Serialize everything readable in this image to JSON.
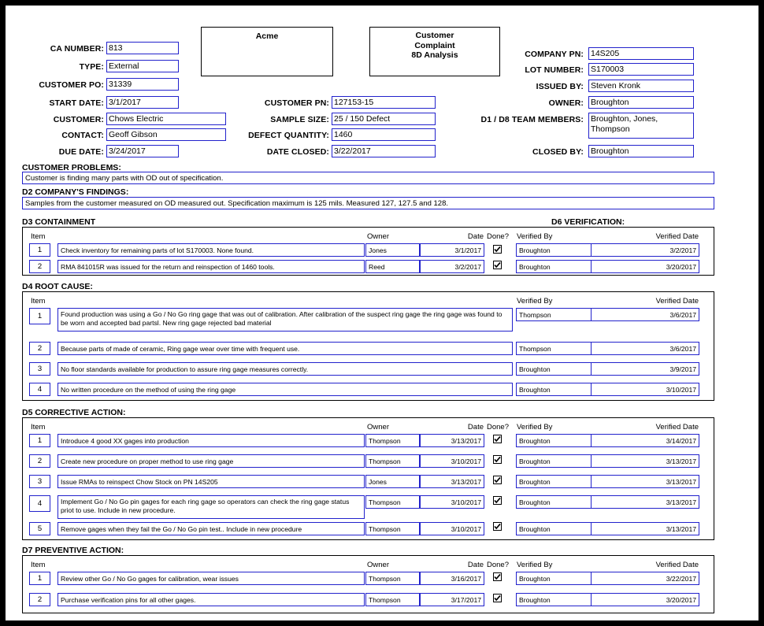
{
  "header": {
    "company_box": "Acme",
    "doc_type_box": "Customer\nComplaint\n8D Analysis",
    "doc_type_line1": "Customer",
    "doc_type_line2": "Complaint",
    "doc_type_line3": "8D Analysis",
    "left_fields": [
      {
        "label": "CA NUMBER:",
        "value": "813"
      },
      {
        "label": "TYPE:",
        "value": "External"
      },
      {
        "label": "CUSTOMER PO:",
        "value": "31339"
      },
      {
        "label": "START DATE:",
        "value": "3/1/2017"
      },
      {
        "label": "CUSTOMER:",
        "value": "Chows Electric"
      },
      {
        "label": "CONTACT:",
        "value": "Geoff Gibson"
      },
      {
        "label": "DUE DATE:",
        "value": "3/24/2017"
      }
    ],
    "mid_fields": [
      {
        "label": "CUSTOMER PN:",
        "value": "127153-15"
      },
      {
        "label": "SAMPLE SIZE:",
        "value": "25 / 150 Defect"
      },
      {
        "label": "DEFECT QUANTITY:",
        "value": "1460"
      },
      {
        "label": "DATE CLOSED:",
        "value": "3/22/2017"
      }
    ],
    "right_fields": [
      {
        "label": "COMPANY PN:",
        "value": "14S205"
      },
      {
        "label": "LOT NUMBER:",
        "value": "S170003"
      },
      {
        "label": "ISSUED BY:",
        "value": "Steven Kronk"
      },
      {
        "label": "OWNER:",
        "value": "Broughton"
      },
      {
        "label": "D1 / D8 TEAM MEMBERS:",
        "value": "Broughton, Jones, Thompson"
      },
      {
        "label": "CLOSED BY:",
        "value": "Broughton"
      }
    ]
  },
  "customer_problems": {
    "title": "CUSTOMER PROBLEMS:",
    "text": "Customer is finding many parts with OD out of specification."
  },
  "d2": {
    "title": "D2 COMPANY'S FINDINGS:",
    "text": "Samples from the customer measured on OD measured out.  Specification maximum is 125 mils.  Measured 127, 127.5 and 128."
  },
  "d3": {
    "title": "D3 CONTAINMENT",
    "verification_title": "D6  VERIFICATION:",
    "columns": {
      "item": "Item",
      "owner": "Owner",
      "date": "Date",
      "done": "Done?",
      "verified_by": "Verified By",
      "verified_date": "Verified Date"
    },
    "rows": [
      {
        "item": "1",
        "action": "Check inventory for remaining parts of lot S170003.  None found.",
        "owner": "Jones",
        "date": "3/1/2017",
        "done": true,
        "verified_by": "Broughton",
        "verified_date": "3/2/2017"
      },
      {
        "item": "2",
        "action": "RMA 841015R was issued for the return and reinspection of 1460 tools.",
        "owner": "Reed",
        "date": "3/2/2017",
        "done": true,
        "verified_by": "Broughton",
        "verified_date": "3/20/2017"
      }
    ]
  },
  "d4": {
    "title": "D4  ROOT CAUSE:",
    "columns": {
      "item": "Item",
      "verified_by": "Verified By",
      "verified_date": "Verified Date"
    },
    "rows": [
      {
        "item": "1",
        "action": "Found production was using a  Go / No Go ring gage that was out of calibration.  After calibration of the suspect ring gage the ring gage was found to be worn and accepted bad partsl.  New ring gage rejected bad material",
        "verified_by": "Thompson",
        "verified_date": "3/6/2017"
      },
      {
        "item": "2",
        "action": "Because parts of made of ceramic, Ring gage wear over time with frequent use.",
        "verified_by": "Thompson",
        "verified_date": "3/6/2017"
      },
      {
        "item": "3",
        "action": "No floor standards  available for production to assure ring gage measures correctly.",
        "verified_by": "Broughton",
        "verified_date": "3/9/2017"
      },
      {
        "item": "4",
        "action": "No written procedure on the method of using the ring gage",
        "verified_by": "Broughton",
        "verified_date": "3/10/2017"
      }
    ]
  },
  "d5": {
    "title": "D5  CORRECTIVE ACTION:",
    "columns": {
      "item": "Item",
      "owner": "Owner",
      "date": "Date",
      "done": "Done?",
      "verified_by": "Verified By",
      "verified_date": "Verified Date"
    },
    "rows": [
      {
        "item": "1",
        "action": "Introduce 4 good XX gages into production",
        "owner": "Thompson",
        "date": "3/13/2017",
        "done": true,
        "verified_by": "Broughton",
        "verified_date": "3/14/2017"
      },
      {
        "item": "2",
        "action": "Create new procedure on proper method to use ring gage",
        "owner": "Thompson",
        "date": "3/10/2017",
        "done": true,
        "verified_by": "Broughton",
        "verified_date": "3/13/2017"
      },
      {
        "item": "3",
        "action": "Issue RMAs to reinspect Chow Stock on PN 14S205",
        "owner": "Jones",
        "date": "3/13/2017",
        "done": true,
        "verified_by": "Broughton",
        "verified_date": "3/13/2017"
      },
      {
        "item": "4",
        "action": "Implement Go / No Go pin gages for each ring gage so operators can check the ring gage status priot to use.  Include in new procedure.",
        "owner": "Thompson",
        "date": "3/10/2017",
        "done": true,
        "verified_by": "Broughton",
        "verified_date": "3/13/2017"
      },
      {
        "item": "5",
        "action": "Remove gages when they fail the Go / No Go pin test..  Include in new procedure",
        "owner": "Thompson",
        "date": "3/10/2017",
        "done": true,
        "verified_by": "Broughton",
        "verified_date": "3/13/2017"
      }
    ]
  },
  "d7": {
    "title": "D7  PREVENTIVE ACTION:",
    "columns": {
      "item": "Item",
      "owner": "Owner",
      "date": "Date",
      "done": "Done?",
      "verified_by": "Verified By",
      "verified_date": "Verified Date"
    },
    "rows": [
      {
        "item": "1",
        "action": "Review other Go / No Go gages for calibration, wear issues",
        "owner": "Thompson",
        "date": "3/16/2017",
        "done": true,
        "verified_by": "Broughton",
        "verified_date": "3/22/2017"
      },
      {
        "item": "2",
        "action": "Purchase verification pins for all other gages.",
        "owner": "Thompson",
        "date": "3/17/2017",
        "done": true,
        "verified_by": "Broughton",
        "verified_date": "3/20/2017"
      }
    ]
  },
  "colors": {
    "field_border": "#2222cc",
    "frame": "#000000",
    "background": "#ffffff"
  }
}
